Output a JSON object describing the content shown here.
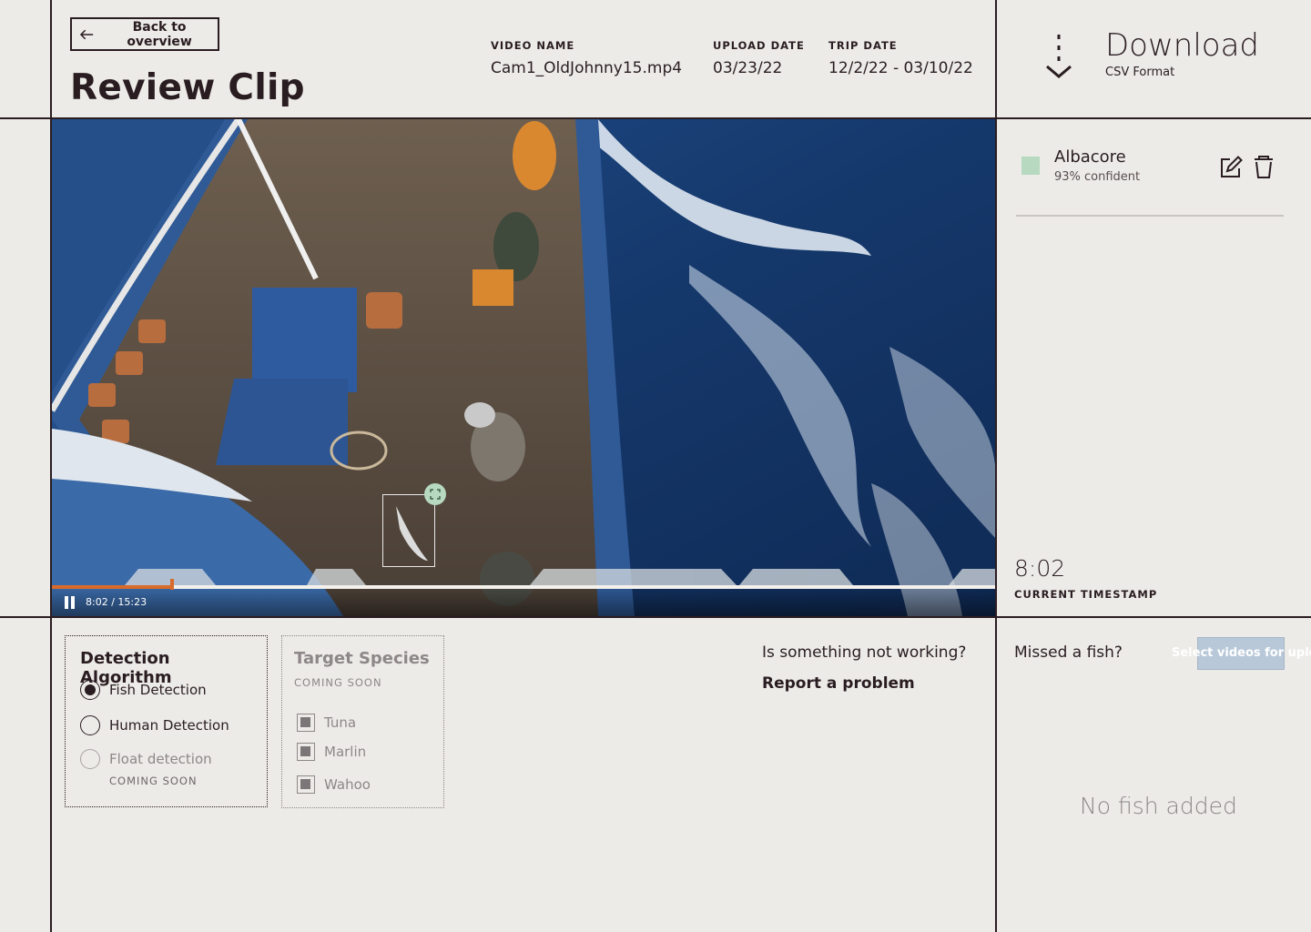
{
  "header": {
    "back_label": "Back to overview",
    "title": "Review Clip",
    "meta": [
      {
        "label": "VIDEO NAME",
        "value": "Cam1_OldJohnny15.mp4"
      },
      {
        "label": "UPLOAD DATE",
        "value": "03/23/22"
      },
      {
        "label": "TRIP DATE",
        "value": "12/2/22 - 03/10/22"
      }
    ],
    "download": {
      "title": "Download",
      "subtitle": "CSV Format",
      "icon": "download-arrow-icon"
    }
  },
  "video": {
    "time_readout": "8:02 / 15:23",
    "progress_fraction": 0.1276,
    "playing": true,
    "accent_color": "#d96b2a",
    "detection_color": "#b6d9c0"
  },
  "detections": [
    {
      "species": "Albacore",
      "confidence": "93% confident",
      "color": "#b6d9c0"
    }
  ],
  "timestamp": {
    "value": "8:02",
    "label": "CURRENT TIMESTAMP"
  },
  "detection_algorithm": {
    "title": "Detection Algorithm",
    "options": [
      {
        "label": "Fish Detection",
        "selected": true,
        "disabled": false
      },
      {
        "label": "Human Detection",
        "selected": false,
        "disabled": false
      },
      {
        "label": "Float detection",
        "selected": false,
        "disabled": true
      }
    ],
    "coming_soon": "COMING SOON"
  },
  "target_species": {
    "title": "Target Species",
    "coming_soon": "COMING SOON",
    "options": [
      "Tuna",
      "Marlin",
      "Wahoo"
    ]
  },
  "help": {
    "question": "Is something not working?",
    "link": "Report a problem"
  },
  "missed": {
    "label": "Missed a fish?",
    "upload_label": "Select videos for upload",
    "empty": "No fish added"
  }
}
